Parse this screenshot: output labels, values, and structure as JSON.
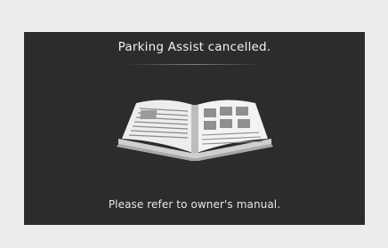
{
  "dialog": {
    "title": "Parking Assist cancelled.",
    "message": "Please refer to owner's manual."
  },
  "icons": {
    "illustration": "open-book-icon"
  },
  "colors": {
    "screen_background": "#2c2c2c",
    "frame_background": "#ececec",
    "text": "#f2f2f2"
  }
}
